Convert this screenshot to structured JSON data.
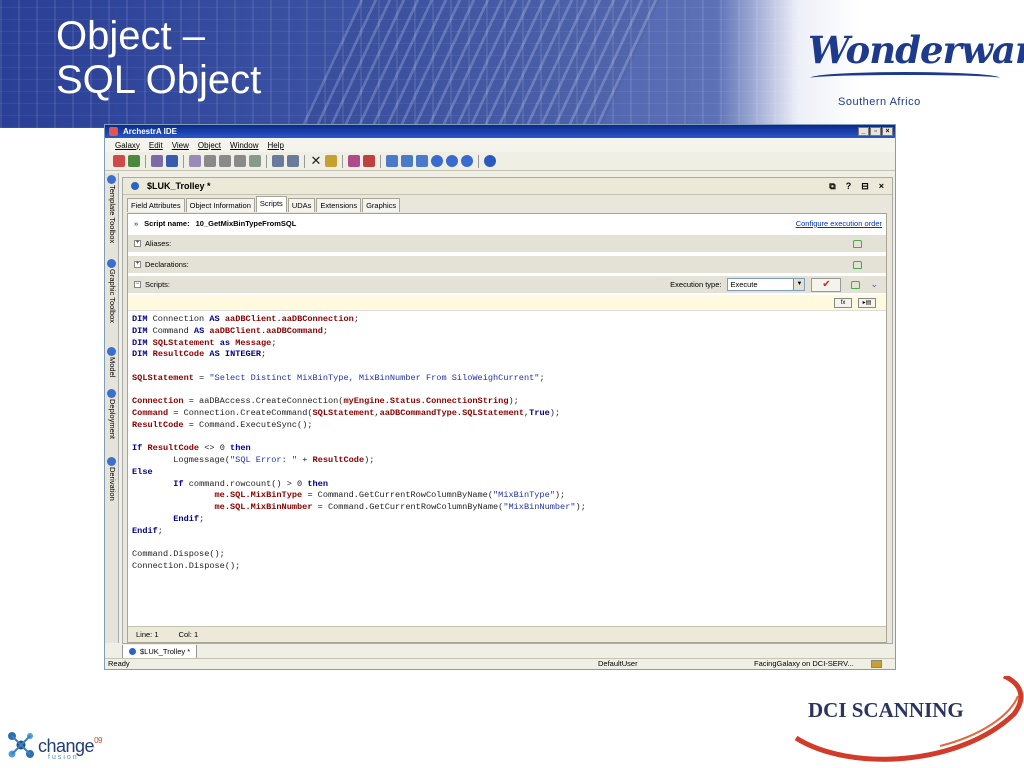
{
  "slide": {
    "title_line1": "Object –",
    "title_line2": "SQL Object",
    "logo_brand": "Wonderware",
    "logo_subtitle": "Southern Africo",
    "footer_left_logo_main": "change",
    "footer_left_logo_sup": "09",
    "footer_left_logo_sub": "fusion",
    "footer_right_logo": "DCI SCANNING"
  },
  "ide": {
    "window_title": "ArchestrA IDE",
    "window_controls": [
      "_",
      "▫",
      "×"
    ],
    "menu": [
      "Galaxy",
      "Edit",
      "View",
      "Object",
      "Window",
      "Help"
    ],
    "side_tabs": [
      "Template Toolbox",
      "Graphic Toolbox",
      "Model",
      "Deployment",
      "Derivation"
    ],
    "editor_title": "$LUK_Trolley *",
    "editor_controls": [
      "⧉",
      "?",
      "⊟",
      "×"
    ],
    "tabs": [
      "Field Attributes",
      "Object Information",
      "Scripts",
      "UDAs",
      "Extensions",
      "Graphics"
    ],
    "active_tab": "Scripts",
    "script_name_label": "Script name:",
    "script_name_value": "10_GetMixBinTypeFromSQL",
    "configure_link": "Configure execution order",
    "sections": {
      "aliases": "Aliases:",
      "declarations": "Declarations:",
      "scripts": "Scripts:"
    },
    "execution_type_label": "Execution type:",
    "execution_type_value": "Execute",
    "code_buttons": [
      "fx",
      "▸▤"
    ],
    "code_lines": [
      "DIM Connection AS aaDBClient.aaDBConnection;",
      "DIM Command AS aaDBClient.aaDBCommand;",
      "DIM SQLStatement as Message;",
      "DIM ResultCode AS INTEGER;",
      "",
      "SQLStatement = \"Select Distinct MixBinType, MixBinNumber From SiloWeighCurrent\";",
      "",
      "Connection = aaDBAccess.CreateConnection(myEngine.Status.ConnectionString);",
      "Command = Connection.CreateCommand(SQLStatement,aaDBCommandType.SQLStatement,True);",
      "ResultCode = Command.ExecuteSync();",
      "",
      "If ResultCode <> 0 then",
      "        Logmessage(\"SQL Error: \" + ResultCode);",
      "Else",
      "        If command.rowcount() > 0 then",
      "                me.SQL.MixBinType = Command.GetCurrentRowColumnByName(\"MixBinType\");",
      "                me.SQL.MixBinNumber = Command.GetCurrentRowColumnByName(\"MixBinNumber\");",
      "        Endif;",
      "Endif;",
      "",
      "Command.Dispose();",
      "Connection.Dispose();"
    ],
    "line_label": "Line:",
    "line_value": "1",
    "col_label": "Col:",
    "col_value": "1",
    "doc_tab": "$LUK_Trolley *",
    "status_ready": "Ready",
    "status_user": "DefaultUser",
    "status_galaxy": "FacingGalaxy on DCI-SERV..."
  },
  "colors": {
    "banner_blue": "#3f56a6",
    "keyword": "#00008b",
    "variable": "#8b0000",
    "string": "#2233aa"
  }
}
